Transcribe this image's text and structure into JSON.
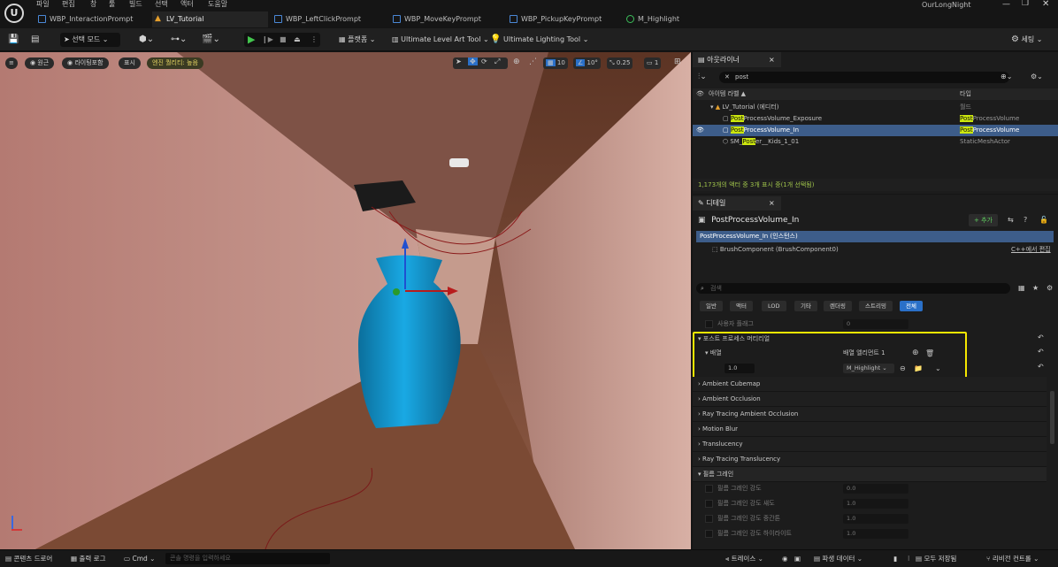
{
  "menu": [
    "파일",
    "편집",
    "창",
    "툴",
    "빌드",
    "선택",
    "액터",
    "도움말"
  ],
  "project_name": "OurLongNight",
  "tabs": [
    {
      "label": "WBP_InteractionPrompt"
    },
    {
      "label": "LV_Tutorial"
    },
    {
      "label": "WBP_LeftClickPrompt"
    },
    {
      "label": "WBP_MoveKeyPrompt"
    },
    {
      "label": "WBP_PickupKeyPrompt"
    },
    {
      "label": "M_Highlight"
    }
  ],
  "toolbar": {
    "select_mode": "선택 모드",
    "platforms": "플랫폼",
    "level_art_tool": "Ultimate Level Art Tool",
    "lighting_tool": "Ultimate Lighting Tool",
    "settings": "세팅"
  },
  "viewport": {
    "perspective": "원근",
    "lit": "라이팅포함",
    "show": "표시",
    "scalability": "엔진 퀄리티: 높음",
    "grid_snap": "10",
    "rot_snap": "10°",
    "scale_snap": "0.25",
    "cam_speed": "1"
  },
  "outliner": {
    "title": "아웃라이너",
    "search_value": "post",
    "col_label": "아이템 라벨 ▲",
    "col_type": "타입",
    "rows": [
      {
        "label": "LV_Tutorial (에디터)",
        "type": "월드"
      },
      {
        "hl": "Post",
        "rest": "ProcessVolume_Exposure",
        "type_hl": "Post",
        "type_rest": "ProcessVolume"
      },
      {
        "hl": "Post",
        "rest": "ProcessVolume_In",
        "type_hl": "Post",
        "type_rest": "ProcessVolume"
      },
      {
        "pre": "SM_",
        "hl": "Post",
        "rest": "er__Kids_1_01",
        "type": "StaticMeshActor"
      }
    ],
    "footer": "1,173개의 액터 중 3개 표시 중(1개 선택됨)"
  },
  "details": {
    "title": "디테일",
    "actor_name": "PostProcessVolume_In",
    "add_label": "+ 추가",
    "instance": "PostProcessVolume_In (인스턴스)",
    "component": "BrushComponent (BrushComponent0)",
    "edit_in_cpp": "C++에서 편집",
    "search_placeholder": "검색",
    "filters": [
      "일반",
      "액터",
      "LOD",
      "기타",
      "렌더링",
      "스트리밍",
      "전체"
    ],
    "user_flags_label": "사용자 플래그",
    "user_flags_value": "0",
    "pp_materials": "포스트 프로세스 머티리얼",
    "array_label": "배열",
    "array_count": "배열 엘리먼트 1",
    "weight": "1.0",
    "material": "M_Highlight",
    "categories": [
      "Ambient Cubemap",
      "Ambient Occlusion",
      "Ray Tracing Ambient Occlusion",
      "Motion Blur",
      "Translucency",
      "Ray Tracing Translucency"
    ],
    "film_grain": "필름 그레인",
    "grain_rows": [
      {
        "label": "필름 그레인 강도",
        "value": "0.0"
      },
      {
        "label": "필름 그레인 강도 섀도",
        "value": "1.0"
      },
      {
        "label": "필름 그레인 강도 중간톤",
        "value": "1.0"
      },
      {
        "label": "필름 그레인 강도 하이라이트",
        "value": "1.0"
      }
    ]
  },
  "status": {
    "content_drawer": "콘텐츠 드로어",
    "output_log": "출력 로그",
    "cmd": "Cmd",
    "console_placeholder": "콘솔 명령을 입력하세요",
    "trace": "트레이스",
    "derived_data": "파생 데이터",
    "save_all": "모두 저장됨",
    "revision": "리비전 컨트롤"
  },
  "accent_yellow": "#f5e600",
  "accent_blue": "#2a70c8",
  "highlight_green": "#cde80e"
}
